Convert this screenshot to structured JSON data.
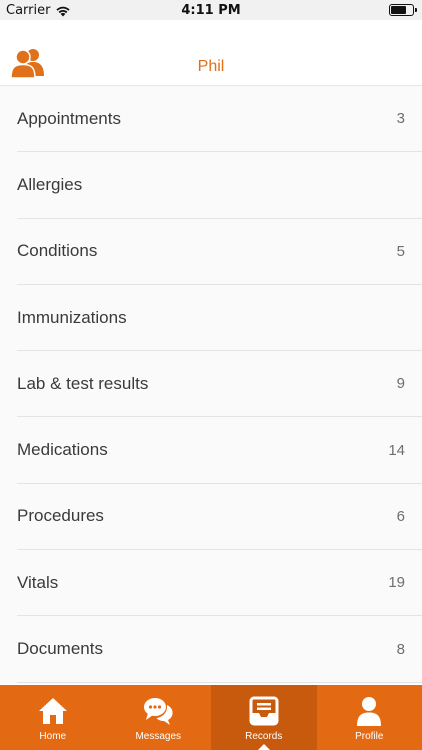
{
  "status_bar": {
    "carrier": "Carrier",
    "time": "4:11 PM"
  },
  "header": {
    "title": "Phil",
    "accent_color": "#e0701a",
    "icon": "people-icon"
  },
  "records": [
    {
      "label": "Appointments",
      "count": "3"
    },
    {
      "label": "Allergies",
      "count": ""
    },
    {
      "label": "Conditions",
      "count": "5"
    },
    {
      "label": "Immunizations",
      "count": ""
    },
    {
      "label": "Lab & test results",
      "count": "9"
    },
    {
      "label": "Medications",
      "count": "14"
    },
    {
      "label": "Procedures",
      "count": "6"
    },
    {
      "label": "Vitals",
      "count": "19"
    },
    {
      "label": "Documents",
      "count": "8"
    }
  ],
  "tabbar": {
    "background": "#e36a13",
    "active_background": "#c75a0c",
    "tabs": [
      {
        "label": "Home",
        "icon": "home-icon"
      },
      {
        "label": "Messages",
        "icon": "chat-bubbles-icon"
      },
      {
        "label": "Records",
        "icon": "inbox-tray-icon",
        "active": true
      },
      {
        "label": "Profile",
        "icon": "person-icon"
      }
    ]
  }
}
